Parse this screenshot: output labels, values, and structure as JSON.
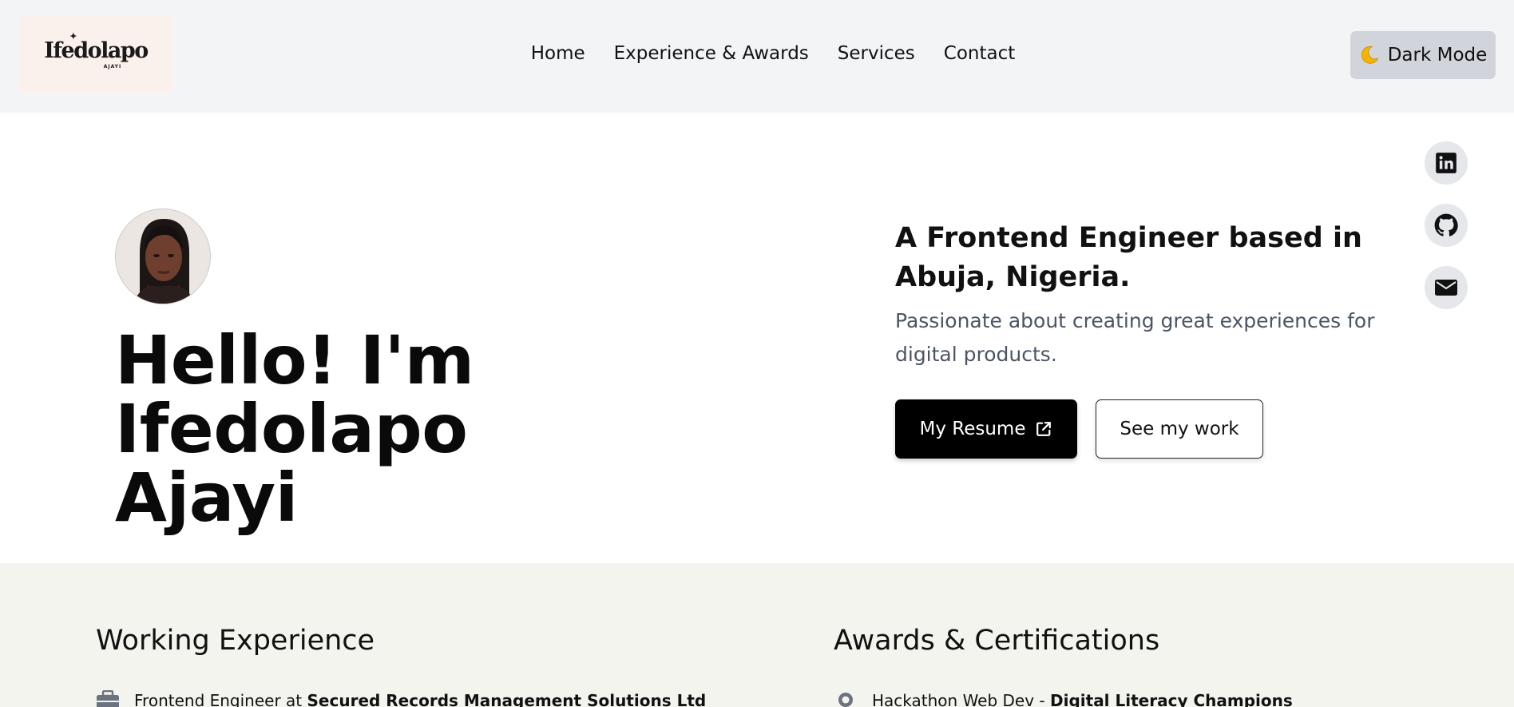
{
  "header": {
    "logo": {
      "main": "Ifedolapo",
      "sub": "AJAYI"
    },
    "nav": [
      "Home",
      "Experience & Awards",
      "Services",
      "Contact"
    ],
    "dark_mode_label": "Dark Mode"
  },
  "social": [
    "linkedin-icon",
    "github-icon",
    "mail-icon"
  ],
  "hero": {
    "title_line1": "Hello! I'm Ifedolapo",
    "title_line2": "Ajayi",
    "tagline": "A Frontend Engineer based in Abuja, Nigeria.",
    "subtext": "Passionate about creating great experiences for digital products.",
    "resume_label": "My Resume",
    "work_label": "See my work"
  },
  "experience": {
    "title": "Working Experience",
    "first_role": "Frontend Engineer at ",
    "first_company": "Secured Records Management Solutions Ltd"
  },
  "awards": {
    "title": "Awards & Certifications",
    "first_award": "Hackathon Web Dev - ",
    "first_org": "Digital Literacy Champions"
  },
  "colors": {
    "header_bg": "#f3f4f6",
    "logo_bg": "#fbf1ec",
    "dark_btn_bg": "#d1d5db",
    "lower_bg": "#f4f4ef",
    "primary": "#000000"
  }
}
